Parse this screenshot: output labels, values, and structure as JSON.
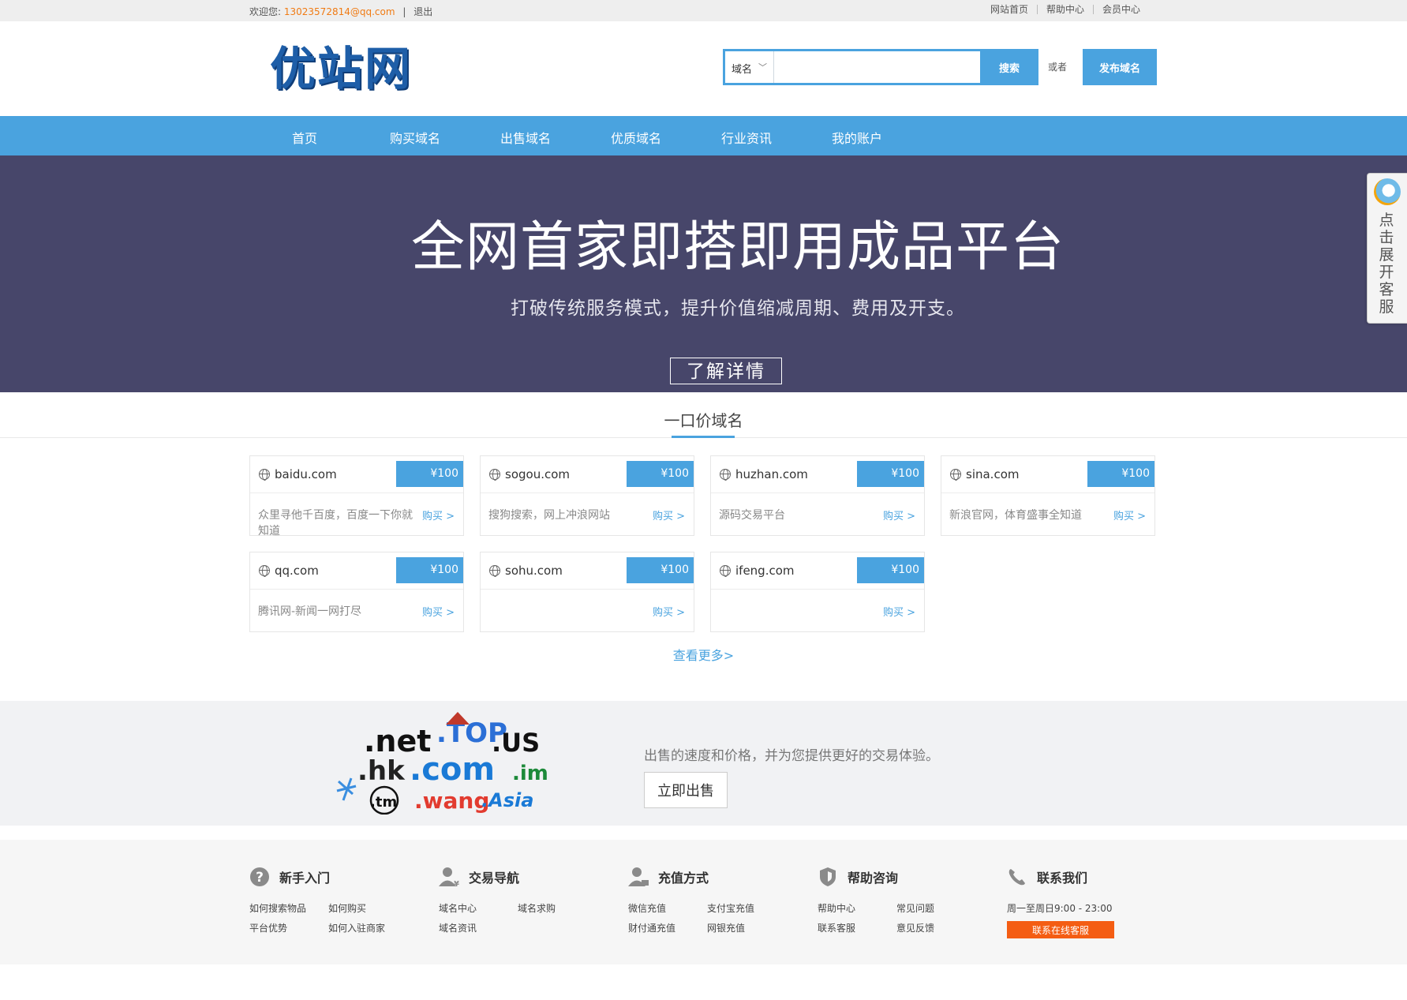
{
  "topbar": {
    "welcome": "欢迎您:",
    "email": "13023572814@qq.com",
    "separator": "|",
    "logout": "退出",
    "links": [
      "网站首页",
      "帮助中心",
      "会员中心"
    ]
  },
  "header": {
    "logo": "优站网",
    "search_type": "域名",
    "search_placeholder": "",
    "search_button": "搜索",
    "or": "或者",
    "publish_button": "发布域名"
  },
  "nav": [
    "首页",
    "购买域名",
    "出售域名",
    "优质域名",
    "行业资讯",
    "我的账户"
  ],
  "banner": {
    "title": "全网首家即搭即用成品平台",
    "subtitle": "打破传统服务模式，提升价值缩减周期、费用及开支。",
    "button": "了解详情"
  },
  "section": {
    "title": "一口价域名",
    "view_more": "查看更多>"
  },
  "domains": [
    {
      "name": "baidu.com",
      "price": "¥100",
      "desc": "众里寻他千百度，百度一下你就知道",
      "buy": "购买 >"
    },
    {
      "name": "sogou.com",
      "price": "¥100",
      "desc": "搜狗搜索，网上冲浪网站",
      "buy": "购买 >"
    },
    {
      "name": "huzhan.com",
      "price": "¥100",
      "desc": "源码交易平台",
      "buy": "购买 >"
    },
    {
      "name": "sina.com",
      "price": "¥100",
      "desc": "新浪官网，体育盛事全知道",
      "buy": "购买 >"
    },
    {
      "name": "qq.com",
      "price": "¥100",
      "desc": "腾讯网-新闻一网打尽",
      "buy": "购买 >"
    },
    {
      "name": "sohu.com",
      "price": "¥100",
      "desc": "",
      "buy": "购买 >"
    },
    {
      "name": "ifeng.com",
      "price": "¥100",
      "desc": "",
      "buy": "购买 >"
    }
  ],
  "sell": {
    "tlds": [
      ".net",
      ".TOP",
      ".US",
      ".hk",
      ".com",
      ".im",
      ".tm",
      ".wang",
      ".Asia"
    ],
    "text": "出售的速度和价格，并为您提供更好的交易体验。",
    "button": "立即出售"
  },
  "footer": {
    "columns": [
      {
        "title": "新手入门",
        "icon": "question-icon",
        "links": [
          "如何搜索物品",
          "如何购买",
          "平台优势",
          "如何入驻商家"
        ]
      },
      {
        "title": "交易导航",
        "icon": "user-trade-icon",
        "links": [
          "域名中心",
          "域名求购",
          "域名资讯"
        ]
      },
      {
        "title": "充值方式",
        "icon": "user-wallet-icon",
        "links": [
          "微信充值",
          "支付宝充值",
          "财付通充值",
          "网银充值"
        ]
      },
      {
        "title": "帮助咨询",
        "icon": "shield-icon",
        "links": [
          "帮助中心",
          "常见问题",
          "联系客服",
          "意见反馈"
        ]
      }
    ],
    "contact": {
      "title": "联系我们",
      "icon": "phone-icon",
      "hours": "周一至周日9:00 - 23:00",
      "button": "联系在线客服"
    }
  },
  "sidetab": {
    "icon": "qq-icon",
    "label": "点击展开客服"
  },
  "colors": {
    "accent": "#4aa3df",
    "banner_bg": "#47466a",
    "orange": "#f45d13",
    "email": "#f07b14"
  }
}
